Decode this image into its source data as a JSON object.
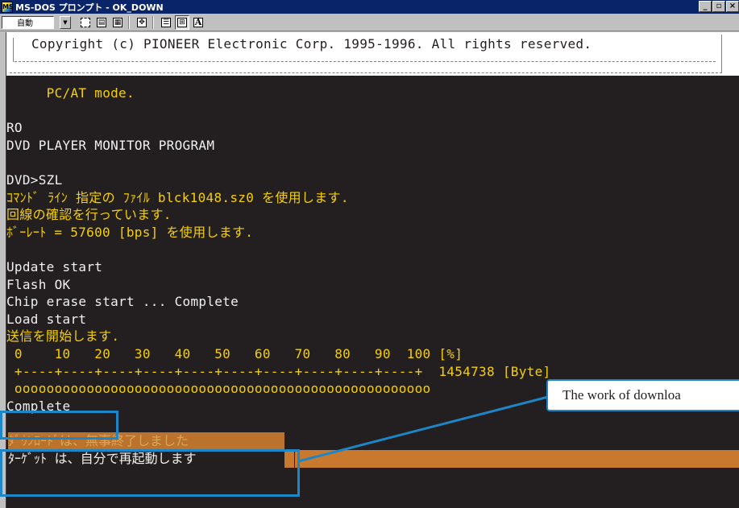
{
  "window": {
    "title": "MS-DOS プロンプト - OK_DOWN",
    "icon": "msdos-icon"
  },
  "toolbar": {
    "font_select_value": "自動",
    "buttons": [
      "mark-icon",
      "copy-icon",
      "paste-icon",
      "fullscreen-icon",
      "properties-icon",
      "background-icon",
      "font-icon"
    ],
    "font_button_label": "A"
  },
  "terminal": {
    "copyright": "Copyright (c) PIONEER Electronic Corp. 1995-1996. All rights reserved.",
    "lines": [
      {
        "text": "     PC/AT mode.",
        "color": "yellow"
      },
      {
        "text": "",
        "color": "white"
      },
      {
        "text": "RO",
        "color": "white"
      },
      {
        "text": "DVD PLAYER MONITOR PROGRAM",
        "color": "white"
      },
      {
        "text": "",
        "color": "white"
      },
      {
        "text": "DVD>SZL",
        "color": "white"
      },
      {
        "text": "ｺﾏﾝﾄﾞ ﾗｲﾝ 指定の ﾌｧｲﾙ blck1048.sz0 を使用します.",
        "color": "yellow"
      },
      {
        "text": "回線の確認を行っています.",
        "color": "yellow"
      },
      {
        "text": "ﾎﾞｰﾚｰﾄ = 57600 [bps] を使用します.",
        "color": "yellow"
      },
      {
        "text": "",
        "color": "white"
      },
      {
        "text": "Update start",
        "color": "white"
      },
      {
        "text": "Flash OK",
        "color": "white"
      },
      {
        "text": "Chip erase start ... Complete",
        "color": "white"
      },
      {
        "text": "Load start",
        "color": "white"
      },
      {
        "text": "送信を開始します.",
        "color": "yellow"
      },
      {
        "text": " 0    10   20   30   40   50   60   70   80   90  100 [%]",
        "color": "yellow"
      },
      {
        "text": " +----+----+----+----+----+----+----+----+----+----+  1454738 [Byte]",
        "color": "yellow"
      },
      {
        "text": " oooooooooooooooooooooooooooooooooooooooooooooooooooo",
        "color": "yellow"
      },
      {
        "text": "Complete",
        "color": "white"
      }
    ],
    "download_done": "ﾀﾞｳﾝﾛｰﾄﾞは、無事終了しました",
    "restart_msg": "ﾀｰｹﾞｯﾄ は、自分で再起動します"
  },
  "callout": {
    "text": "The work of downloa"
  },
  "colors": {
    "terminal_bg": "#231f20",
    "terminal_yellow": "#f6d000",
    "highlight_blue": "#1d86c6",
    "selection_orange": "#c8792e",
    "titlebar_blue": "#0a246a"
  }
}
